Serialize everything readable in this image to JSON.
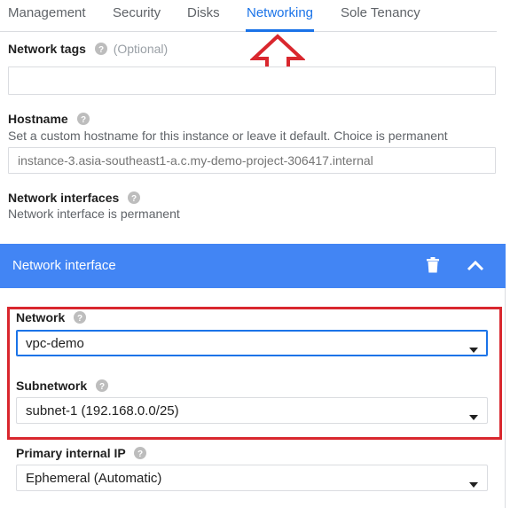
{
  "tabs": [
    {
      "label": "Management"
    },
    {
      "label": "Security"
    },
    {
      "label": "Disks"
    },
    {
      "label": "Networking",
      "active": true
    },
    {
      "label": "Sole Tenancy"
    }
  ],
  "network_tags": {
    "label": "Network tags",
    "optional": "(Optional)",
    "value": ""
  },
  "hostname": {
    "label": "Hostname",
    "description": "Set a custom hostname for this instance or leave it default. Choice is permanent",
    "placeholder": "instance-3.asia-southeast1-a.c.my-demo-project-306417.internal"
  },
  "network_interfaces": {
    "label": "Network interfaces",
    "description": "Network interface is permanent"
  },
  "network_interface_panel": {
    "title": "Network interface",
    "network": {
      "label": "Network",
      "value": "vpc-demo"
    },
    "subnetwork": {
      "label": "Subnetwork",
      "value": "subnet-1 (192.168.0.0/25)"
    },
    "primary_ip": {
      "label": "Primary internal IP",
      "value": "Ephemeral (Automatic)"
    }
  },
  "colors": {
    "accent": "#1a73e8",
    "header": "#4285f4",
    "highlight": "#d9272e"
  }
}
